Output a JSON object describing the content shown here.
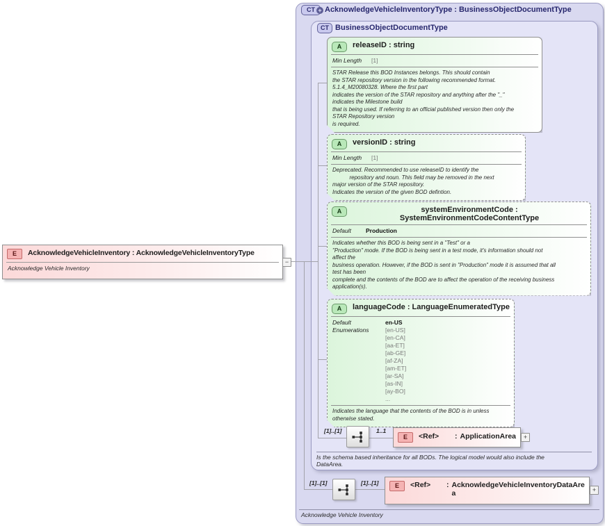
{
  "colors": {
    "container_fill": "#d9d9f0",
    "inner_fill": "#e4e4f7",
    "attribute_green": "#dcf5dc",
    "element_pink": "#fcd9d9",
    "title_navy": "#28286e",
    "connector_gray": "#a2a2aa"
  },
  "root_element": {
    "kind": "E",
    "title": "AcknowledgeVehicleInventory : AcknowledgeVehicleInventoryType",
    "annotation": "Acknowledge Vehicle Inventory",
    "collapse_glyph": "−"
  },
  "container": {
    "kind": "CT",
    "plus_glyph": "+",
    "title": "AcknowledgeVehicleInventoryType : BusinessObjectDocumentType",
    "annotation": "Acknowledge Vehicle Inventory"
  },
  "base_type": {
    "kind": "CT",
    "title": "BusinessObjectDocumentType",
    "annotation": "Is the schema based inheritance for all BODs. The logical model would also include the\nDataArea."
  },
  "attributes": [
    {
      "kind": "A",
      "name": "releaseID : string",
      "facets": [
        {
          "label": "Min Length",
          "value": "[1]"
        }
      ],
      "description": "STAR Release this BOD Instances belongs. This should contain\nthe STAR repository version in the following recommended format.\n5.1.4_M20080328. Where the first part\nindicates the version of the STAR repository and anything after the \"_\"\nindicates the Milestone build\nthat is being used. If referring to an official published version then only the\nSTAR Repository version\nis required."
    },
    {
      "kind": "A",
      "name": "versionID : string",
      "facets": [
        {
          "label": "Min Length",
          "value": "[1]"
        }
      ],
      "description": "Deprecated. Recommended to use releaseID to identify the\n           repository and noun. This field may be removed in the next\nmajor version of the STAR repository.\nIndicates the version of the given BOD defintion."
    },
    {
      "kind": "A",
      "name": "systemEnvironmentCode : SystemEnvironmentCodeContentType",
      "facets": [
        {
          "label": "Default",
          "value": "Production"
        }
      ],
      "description": "Indicates whether this BOD is being sent in a \"Test\" or a\n\"Production\" mode. If the BOD is being sent in a test mode, it's information should not\naffect the\nbusiness operation. However, if the BOD is sent in \"Production\" mode it is assumed that all\ntest has been\ncomplete and the contents of the BOD are to affect the operation of the receiving business\napplication(s)."
    },
    {
      "kind": "A",
      "name": "languageCode : LanguageEnumeratedType",
      "default_label": "Default",
      "default_value": "en-US",
      "enum_label": "Enumerations",
      "enums": [
        "[en-US]",
        "[en-CA]",
        "[aa-ET]",
        "[ab-GE]",
        "[af-ZA]",
        "[am-ET]",
        "[ar-SA]",
        "[as-IN]",
        "[ay-BO]",
        "..."
      ],
      "description": "Indicates the language that the contents of the BOD is in unless\notherwise stated."
    }
  ],
  "application_area": {
    "occurs_left": "[1]..[1]",
    "occurs_right": "1..1",
    "kind": "E",
    "ref_label": "<Ref>",
    "colon": ":",
    "type_name": "ApplicationArea",
    "expand_glyph": "+"
  },
  "data_area": {
    "occurs_left": "[1]..[1]",
    "occurs_right": "[1]..[1]",
    "kind": "E",
    "ref_label": "<Ref>",
    "colon": ":",
    "type_name": "AcknowledgeVehicleInventoryDataArea",
    "expand_glyph": "+"
  }
}
